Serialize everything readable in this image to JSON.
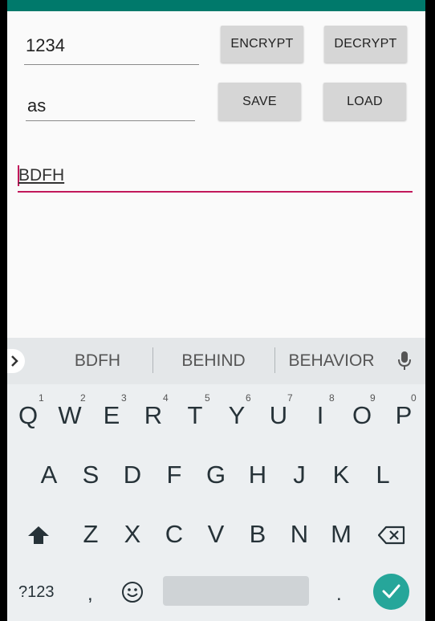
{
  "form": {
    "key_value": "1234",
    "name_value": "as",
    "output_value": "BDFH",
    "encrypt_label": "ENCRYPT",
    "decrypt_label": "DECRYPT",
    "save_label": "SAVE",
    "load_label": "LOAD"
  },
  "keyboard": {
    "suggestions": [
      "BDFH",
      "BEHIND",
      "BEHAVIOR"
    ],
    "row1": [
      "Q",
      "W",
      "E",
      "R",
      "T",
      "Y",
      "U",
      "I",
      "O",
      "P"
    ],
    "row1_hints": [
      "1",
      "2",
      "3",
      "4",
      "5",
      "6",
      "7",
      "8",
      "9",
      "0"
    ],
    "row2": [
      "A",
      "S",
      "D",
      "F",
      "G",
      "H",
      "J",
      "K",
      "L"
    ],
    "row3": [
      "Z",
      "X",
      "C",
      "V",
      "B",
      "N",
      "M"
    ],
    "symbols_label": "?123",
    "comma": ",",
    "period": "."
  },
  "colors": {
    "statusbar": "#00796b",
    "accent": "#c2185b",
    "enter": "#26a69a"
  }
}
